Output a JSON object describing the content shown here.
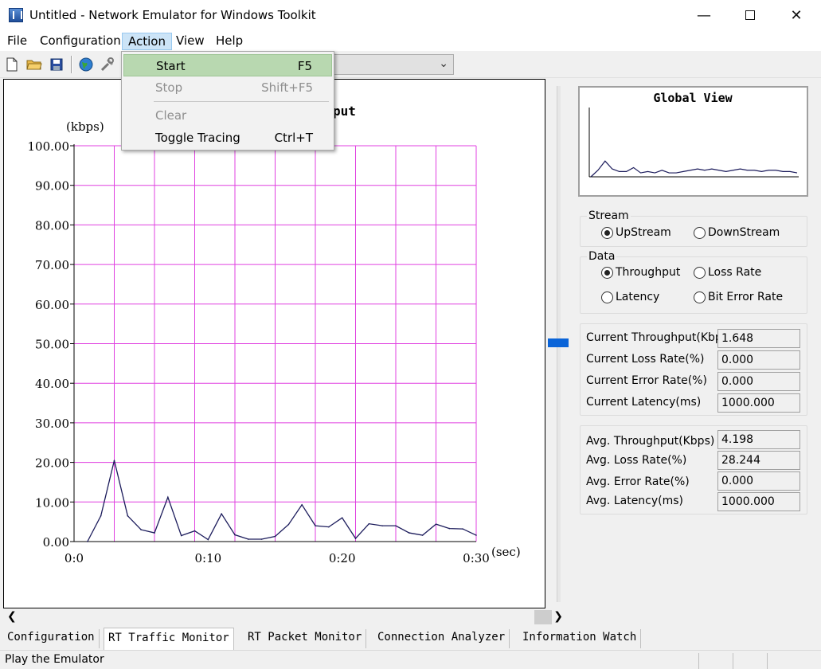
{
  "window": {
    "title": "Untitled - Network Emulator for Windows Toolkit"
  },
  "menu": {
    "file": "File",
    "configuration": "Configuration",
    "action": "Action",
    "view": "View",
    "help": "Help"
  },
  "action_menu": [
    {
      "label": "Start",
      "shortcut": "F5",
      "enabled": true,
      "highlighted": true
    },
    {
      "label": "Stop",
      "shortcut": "Shift+F5",
      "enabled": false
    },
    {
      "label": "Clear",
      "shortcut": "",
      "enabled": false
    },
    {
      "label": "Toggle Tracing",
      "shortcut": "Ctrl+T",
      "enabled": true
    }
  ],
  "toolbar": {
    "icons": [
      "new-file-icon",
      "open-folder-icon",
      "save-icon",
      "globe-icon",
      "tools-icon"
    ],
    "combo_value": ""
  },
  "chart_title_visible_fragment": "put",
  "chart_data": {
    "type": "line",
    "ylabel": "(kbps)",
    "xlabel": "(sec)",
    "ylim": [
      0,
      100
    ],
    "xlim": [
      0,
      30
    ],
    "y_ticks": [
      "100.00",
      "90.00",
      "80.00",
      "70.00",
      "60.00",
      "50.00",
      "40.00",
      "30.00",
      "20.00",
      "10.00",
      "0.00"
    ],
    "x_ticks": [
      {
        "value": 0,
        "label": "0:0"
      },
      {
        "value": 10,
        "label": "0:10"
      },
      {
        "value": 20,
        "label": "0:20"
      },
      {
        "value": 30,
        "label": "0:30"
      }
    ],
    "grid": true,
    "grid_color": "#e040e0",
    "line_color": "#1c1c5c",
    "x": [
      1,
      2,
      3,
      4,
      5,
      6,
      7,
      8,
      9,
      10,
      11,
      12,
      13,
      14,
      15,
      16,
      17,
      18,
      19,
      20,
      21,
      22,
      23,
      24,
      25,
      26,
      27,
      28,
      29,
      30
    ],
    "values": [
      0.0,
      6.5,
      20.5,
      6.5,
      3.0,
      2.2,
      11.2,
      1.5,
      2.7,
      0.5,
      7.0,
      1.7,
      0.6,
      0.6,
      1.3,
      4.3,
      9.3,
      4.0,
      3.7,
      6.0,
      0.8,
      4.5,
      4.0,
      4.0,
      2.2,
      1.6,
      4.4,
      3.3,
      3.2,
      1.6
    ]
  },
  "global_view": {
    "title": "Global View",
    "values": [
      0,
      5,
      12,
      6,
      4,
      4,
      7,
      3,
      4,
      3,
      5,
      3,
      3,
      4,
      5,
      6,
      5,
      6,
      5,
      4,
      5,
      6,
      5,
      5,
      4,
      5,
      5,
      4,
      4,
      3
    ]
  },
  "stream": {
    "title": "Stream",
    "options": [
      "UpStream",
      "DownStream"
    ],
    "selected": "UpStream"
  },
  "data_group": {
    "title": "Data",
    "options": [
      "Throughput",
      "Loss Rate",
      "Latency",
      "Bit Error Rate"
    ],
    "selected": "Throughput"
  },
  "current": {
    "throughput_label": "Current Throughput(Kbps)",
    "throughput": "1.648",
    "loss_label": "Current Loss Rate(%)",
    "loss": "0.000",
    "error_label": "Current Error Rate(%)",
    "error": "0.000",
    "latency_label": "Current Latency(ms)",
    "latency": "1000.000"
  },
  "average": {
    "throughput_label": "Avg. Throughput(Kbps)",
    "throughput": "4.198",
    "loss_label": "Avg. Loss Rate(%)",
    "loss": "28.244",
    "error_label": "Avg. Error Rate(%)",
    "error": "0.000",
    "latency_label": "Avg. Latency(ms)",
    "latency": "1000.000"
  },
  "tabs": [
    "Configuration",
    "RT Traffic Monitor",
    "RT Packet Monitor",
    "Connection Analyzer",
    "Information Watch"
  ],
  "active_tab": "RT Traffic Monitor",
  "status": {
    "text": "Play the Emulator"
  }
}
